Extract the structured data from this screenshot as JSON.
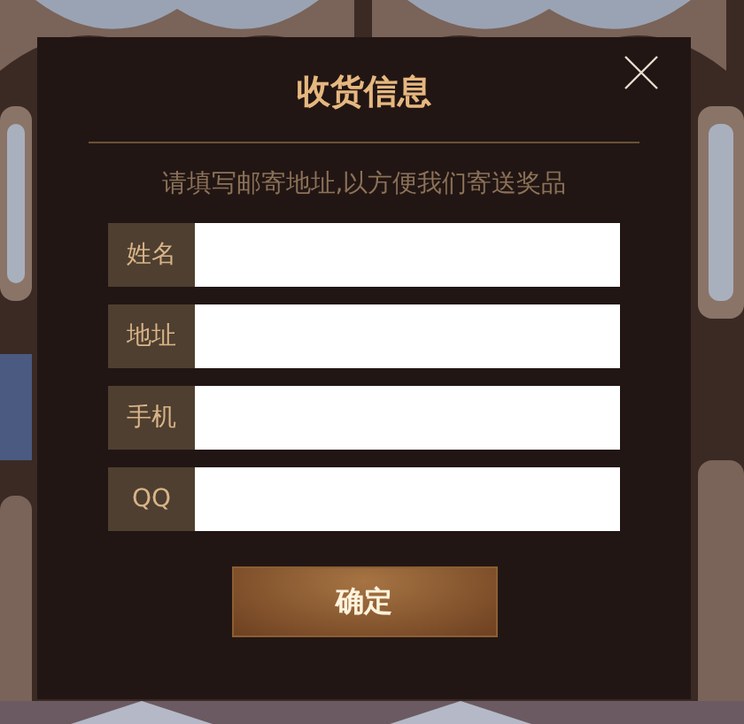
{
  "dialog": {
    "title": "收货信息",
    "subtitle": "请填写邮寄地址,以方便我们寄送奖品",
    "fields": [
      {
        "label": "姓名"
      },
      {
        "label": "地址"
      },
      {
        "label": "手机"
      },
      {
        "label": "QQ"
      }
    ],
    "submit_button": "确定"
  }
}
